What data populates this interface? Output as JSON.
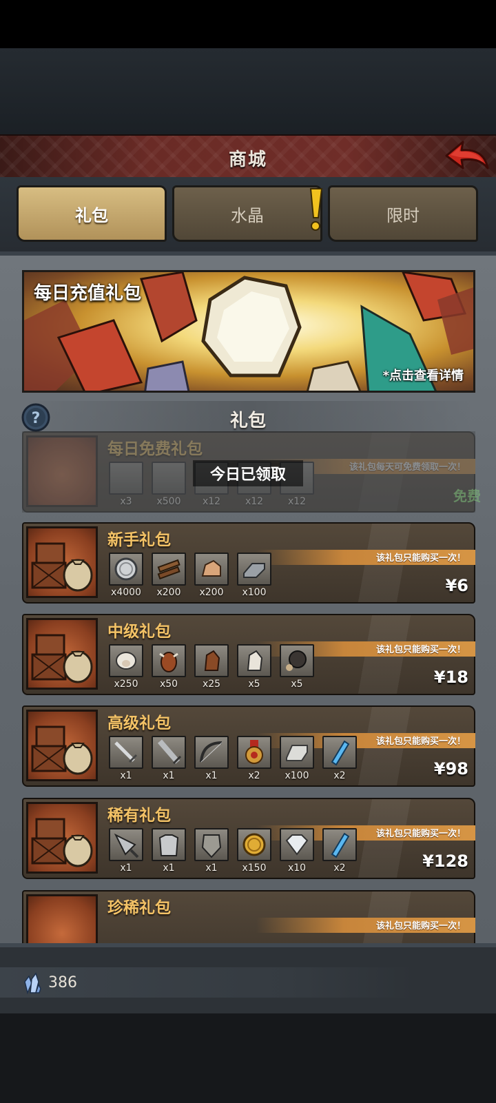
{
  "header": {
    "title": "商城"
  },
  "tabs": [
    {
      "label": "礼包",
      "active": true
    },
    {
      "label": "水晶",
      "active": false,
      "alert": true
    },
    {
      "label": "限时",
      "active": false
    }
  ],
  "banner": {
    "title": "每日充值礼包",
    "hint": "*点击查看详情"
  },
  "section": {
    "title": "礼包"
  },
  "packs": [
    {
      "name": "每日免费礼包",
      "status": "今日已领取",
      "limit_text": "该礼包每天可免费领取一次！",
      "price": "免费",
      "items": [
        {
          "icon": "crystal-ore-icon",
          "qty": "x3"
        },
        {
          "icon": "silver-coin-icon",
          "qty": "x500"
        },
        {
          "icon": "item-icon",
          "qty": "x12"
        },
        {
          "icon": "item-icon",
          "qty": "x12"
        },
        {
          "icon": "item-icon",
          "qty": "x12"
        }
      ]
    },
    {
      "name": "新手礼包",
      "limit_text": "该礼包只能购买一次！",
      "price": "¥6",
      "items": [
        {
          "icon": "silver-coin-icon",
          "qty": "x4000"
        },
        {
          "icon": "wood-planks-icon",
          "qty": "x200"
        },
        {
          "icon": "stone-ore-icon",
          "qty": "x200"
        },
        {
          "icon": "iron-ingot-icon",
          "qty": "x100"
        }
      ]
    },
    {
      "name": "中级礼包",
      "limit_text": "该礼包只能购买一次！",
      "price": "¥18",
      "items": [
        {
          "icon": "sheep-icon",
          "qty": "x250"
        },
        {
          "icon": "cow-icon",
          "qty": "x50"
        },
        {
          "icon": "brown-horse-icon",
          "qty": "x25"
        },
        {
          "icon": "white-horse-icon",
          "qty": "x5"
        },
        {
          "icon": "dark-orb-icon",
          "qty": "x5"
        }
      ]
    },
    {
      "name": "高级礼包",
      "limit_text": "该礼包只能购买一次！",
      "price": "¥98",
      "items": [
        {
          "icon": "sword-icon",
          "qty": "x1"
        },
        {
          "icon": "greatsword-icon",
          "qty": "x1"
        },
        {
          "icon": "bow-icon",
          "qty": "x1"
        },
        {
          "icon": "medal-icon",
          "qty": "x2"
        },
        {
          "icon": "silver-ingot-icon",
          "qty": "x100"
        },
        {
          "icon": "blue-crystal-icon",
          "qty": "x2"
        }
      ]
    },
    {
      "name": "稀有礼包",
      "limit_text": "该礼包只能购买一次！",
      "price": "¥128",
      "items": [
        {
          "icon": "drill-icon",
          "qty": "x1"
        },
        {
          "icon": "armor-icon",
          "qty": "x1"
        },
        {
          "icon": "shield-icon",
          "qty": "x1"
        },
        {
          "icon": "gold-coin-icon",
          "qty": "x150"
        },
        {
          "icon": "diamond-icon",
          "qty": "x10"
        },
        {
          "icon": "blue-crystal-icon",
          "qty": "x2"
        }
      ]
    },
    {
      "name": "珍稀礼包",
      "limit_text": "该礼包只能购买一次！",
      "price": "",
      "items": []
    }
  ],
  "footer": {
    "currency_value": "386",
    "currency_icon": "crystal-icon"
  },
  "colors": {
    "accent_gold": "#f3c266",
    "limit_orange": "#d69545",
    "title_red": "#6f2d28"
  }
}
